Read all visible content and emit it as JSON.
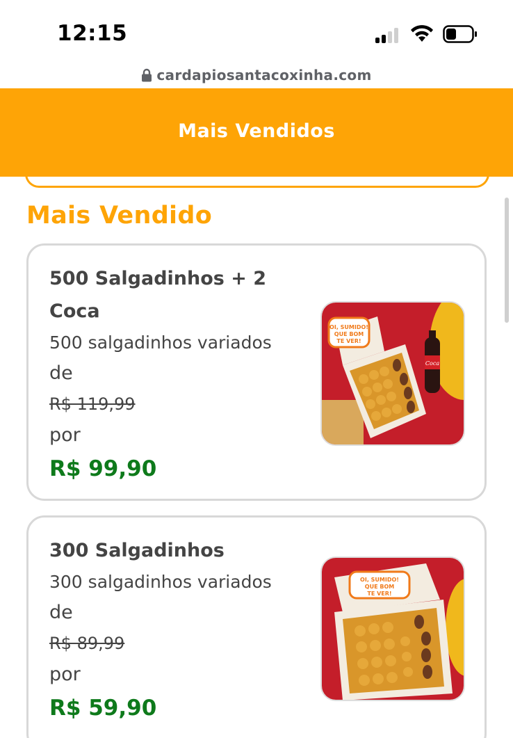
{
  "status_bar": {
    "time": "12:15"
  },
  "browser": {
    "url": "cardapiosantacoxinha.com",
    "lock_icon": "lock-icon"
  },
  "header": {
    "title": "Mais Vendidos",
    "background_color": "#fea406"
  },
  "section": {
    "title": "Mais Vendido",
    "title_color": "#fea406"
  },
  "products": [
    {
      "title": "500 Salgadinhos + 2 Coca",
      "description": "500 salgadinhos variados",
      "from_label": "de",
      "old_price": "R$ 119,99",
      "by_label": "por",
      "price": "R$ 99,90",
      "image_icon": "salgadinhos-box-with-coke-image"
    },
    {
      "title": "300 Salgadinhos",
      "description": "300 salgadinhos variados",
      "from_label": "de",
      "old_price": "R$ 89,99",
      "by_label": "por",
      "price": "R$ 59,90",
      "image_icon": "salgadinhos-box-image"
    }
  ],
  "colors": {
    "accent": "#fea406",
    "price": "#0e7a1b",
    "text": "#444444"
  }
}
